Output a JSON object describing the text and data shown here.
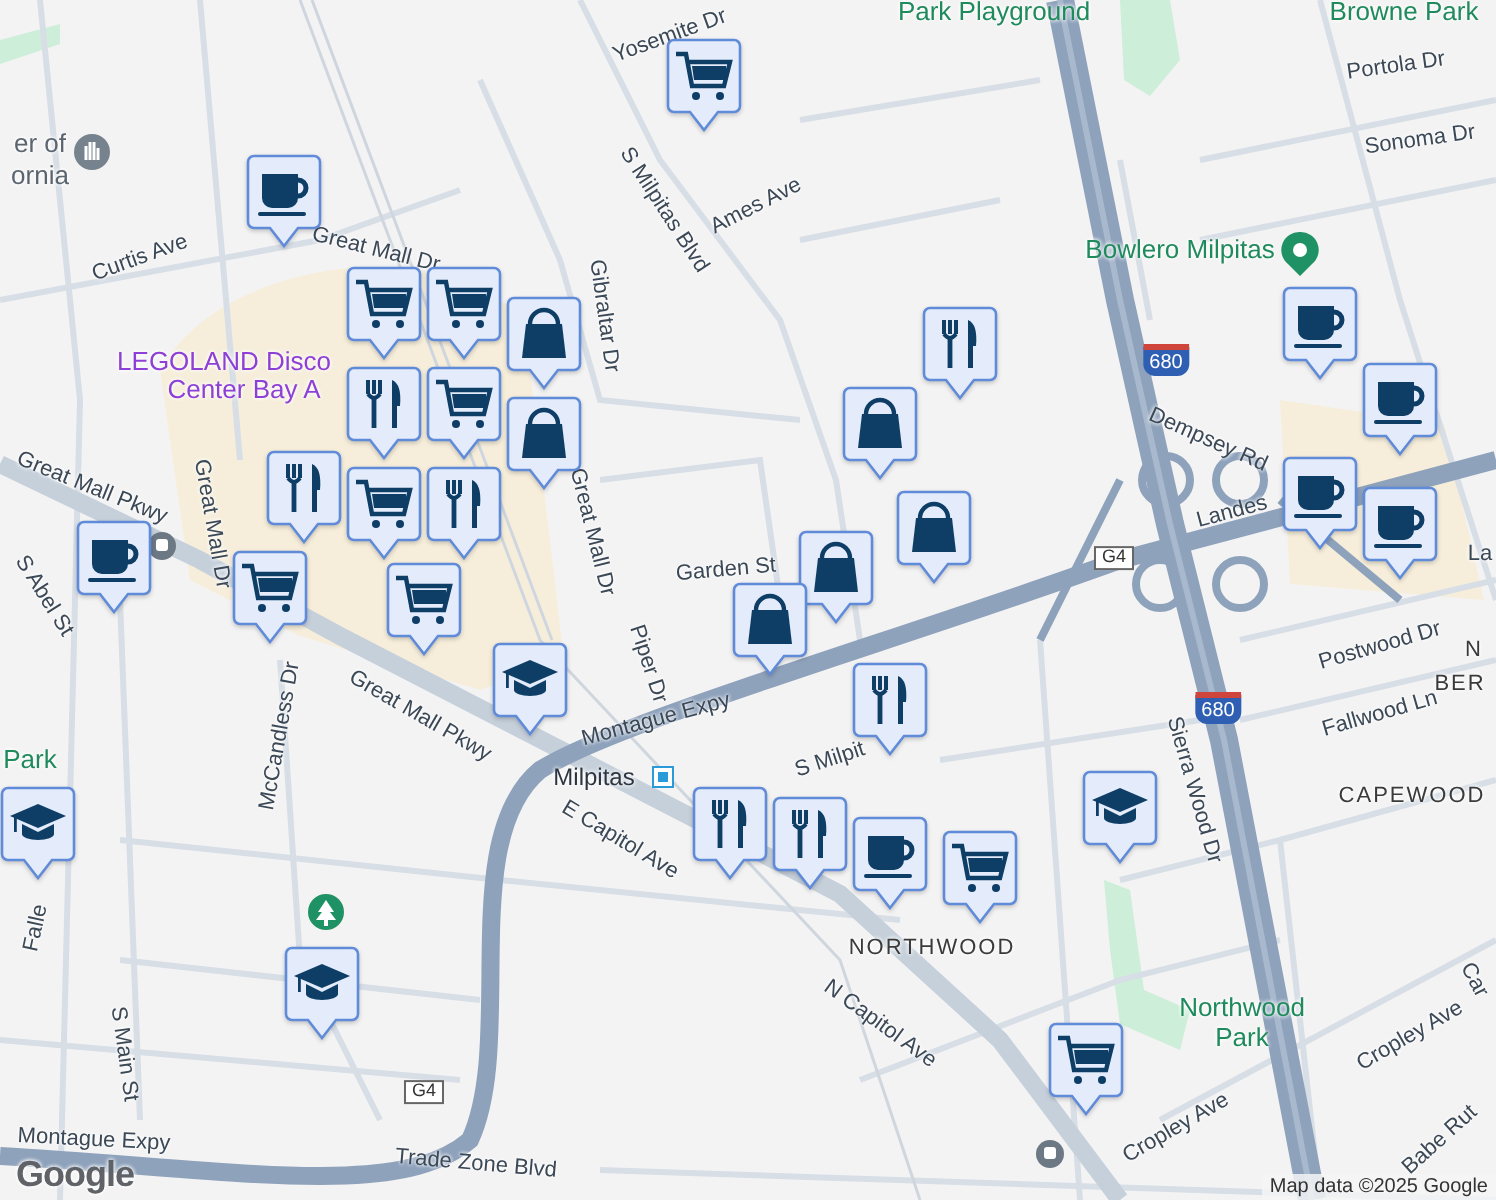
{
  "map": {
    "labels": [
      {
        "text": "Yosemite Dr",
        "kind": "street"
      },
      {
        "text": "Park Playground",
        "kind": "park"
      },
      {
        "text": "Browne Park",
        "kind": "park"
      },
      {
        "text": "Portola Dr",
        "kind": "street"
      },
      {
        "text": "Sonoma Dr",
        "kind": "street"
      },
      {
        "text": "er of",
        "kind": "place"
      },
      {
        "text": "ornia",
        "kind": "place"
      },
      {
        "text": "Curtis Ave",
        "kind": "street"
      },
      {
        "text": "Great Mall Dr",
        "kind": "street"
      },
      {
        "text": "S Milpitas Blvd",
        "kind": "street"
      },
      {
        "text": "Ames Ave",
        "kind": "street"
      },
      {
        "text": "Gibraltar Dr",
        "kind": "street"
      },
      {
        "text": "LEGOLAND Disco",
        "kind": "attraction"
      },
      {
        "text": "Center Bay A",
        "kind": "attraction"
      },
      {
        "text": "Bowlero Milpitas",
        "kind": "park"
      },
      {
        "text": "680",
        "kind": "interstate"
      },
      {
        "text": "Dempsey Rd",
        "kind": "street"
      },
      {
        "text": "Landes",
        "kind": "street"
      },
      {
        "text": "La",
        "kind": "street"
      },
      {
        "text": "Great Mall Pkwy",
        "kind": "street"
      },
      {
        "text": "S Abel St",
        "kind": "street"
      },
      {
        "text": "Great Mall Dr",
        "kind": "street"
      },
      {
        "text": "Great Mall Dr",
        "kind": "street"
      },
      {
        "text": "Piper Dr",
        "kind": "street"
      },
      {
        "text": "Garden St",
        "kind": "street"
      },
      {
        "text": "G4",
        "kind": "county"
      },
      {
        "text": "Montague Expy",
        "kind": "street"
      },
      {
        "text": "Great Mall Pkwy",
        "kind": "street"
      },
      {
        "text": "Milpitas",
        "kind": "transit"
      },
      {
        "text": "E Capitol Ave",
        "kind": "street"
      },
      {
        "text": "S Milpit",
        "kind": "street"
      },
      {
        "text": "McCandless Dr",
        "kind": "street"
      },
      {
        "text": "Park",
        "kind": "park"
      },
      {
        "text": "Falle",
        "kind": "street"
      },
      {
        "text": "S Main St",
        "kind": "street"
      },
      {
        "text": "G4",
        "kind": "county"
      },
      {
        "text": "Montague Expy",
        "kind": "street"
      },
      {
        "text": "Trade Zone Blvd",
        "kind": "street"
      },
      {
        "text": "N Capitol Ave",
        "kind": "street"
      },
      {
        "text": "Sierra Wood Dr",
        "kind": "street"
      },
      {
        "text": "NORTHWOOD",
        "kind": "neighborhood"
      },
      {
        "text": "Northwood",
        "kind": "park"
      },
      {
        "text": "Park",
        "kind": "park"
      },
      {
        "text": "Cropley Ave",
        "kind": "street"
      },
      {
        "text": "Cropley Ave",
        "kind": "street"
      },
      {
        "text": "Postwood Dr",
        "kind": "street"
      },
      {
        "text": "Fallwood Ln",
        "kind": "street"
      },
      {
        "text": "680",
        "kind": "interstate"
      },
      {
        "text": "N",
        "kind": "neighborhood"
      },
      {
        "text": "BER",
        "kind": "neighborhood"
      },
      {
        "text": "CAPEWOOD",
        "kind": "neighborhood"
      },
      {
        "text": "Car",
        "kind": "street"
      },
      {
        "text": "Babe Rut",
        "kind": "street"
      }
    ],
    "markers": [
      {
        "kind": "cart"
      },
      {
        "kind": "coffee"
      },
      {
        "kind": "cart"
      },
      {
        "kind": "bag"
      },
      {
        "kind": "cart"
      },
      {
        "kind": "food"
      },
      {
        "kind": "cart"
      },
      {
        "kind": "cart"
      },
      {
        "kind": "bag"
      },
      {
        "kind": "food"
      },
      {
        "kind": "food"
      },
      {
        "kind": "cart"
      },
      {
        "kind": "coffee"
      },
      {
        "kind": "cart"
      },
      {
        "kind": "school"
      },
      {
        "kind": "food"
      },
      {
        "kind": "bag"
      },
      {
        "kind": "bag"
      },
      {
        "kind": "bag"
      },
      {
        "kind": "bag"
      },
      {
        "kind": "food"
      },
      {
        "kind": "coffee"
      },
      {
        "kind": "coffee"
      },
      {
        "kind": "coffee"
      },
      {
        "kind": "coffee"
      },
      {
        "kind": "school"
      },
      {
        "kind": "school"
      },
      {
        "kind": "school"
      },
      {
        "kind": "food"
      },
      {
        "kind": "food"
      },
      {
        "kind": "coffee"
      },
      {
        "kind": "cart"
      },
      {
        "kind": "cart"
      }
    ]
  },
  "logo": "Google",
  "attribution": "Map data ©2025 Google"
}
